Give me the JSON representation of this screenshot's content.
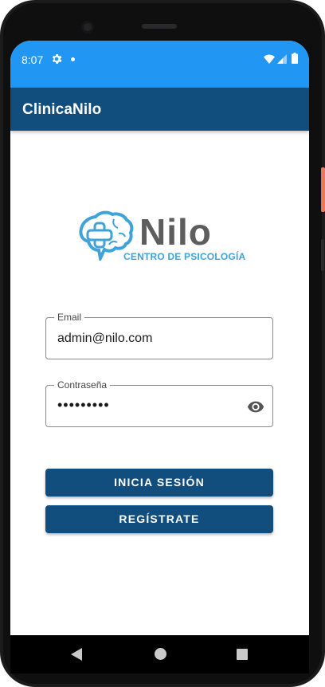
{
  "status_bar": {
    "time": "8:07",
    "icons": [
      "gear-icon",
      "notification-dot-icon",
      "wifi-icon",
      "signal-icon",
      "battery-icon"
    ]
  },
  "app_bar": {
    "title": "ClinicaNilo",
    "color": "#114e7e"
  },
  "logo": {
    "name": "Nilo",
    "subtitle": "CENTRO DE PSICOLOGÍA",
    "icon": "brain-cross-logo-icon"
  },
  "form": {
    "email": {
      "label": "Email",
      "value": "admin@nilo.com"
    },
    "password": {
      "label": "Contraseña",
      "value": "•••••••••",
      "toggle_icon": "eye-icon"
    }
  },
  "buttons": {
    "login_label": "INICIA SESIÓN",
    "register_label": "REGÍSTRATE"
  },
  "nav_bar": {
    "icons": [
      "back-icon",
      "home-icon",
      "recents-icon"
    ]
  },
  "colors": {
    "status_bar": "#2196f3",
    "primary": "#114e7e",
    "logo_blue": "#3fa3d9",
    "logo_gray": "#5d5d5d"
  }
}
